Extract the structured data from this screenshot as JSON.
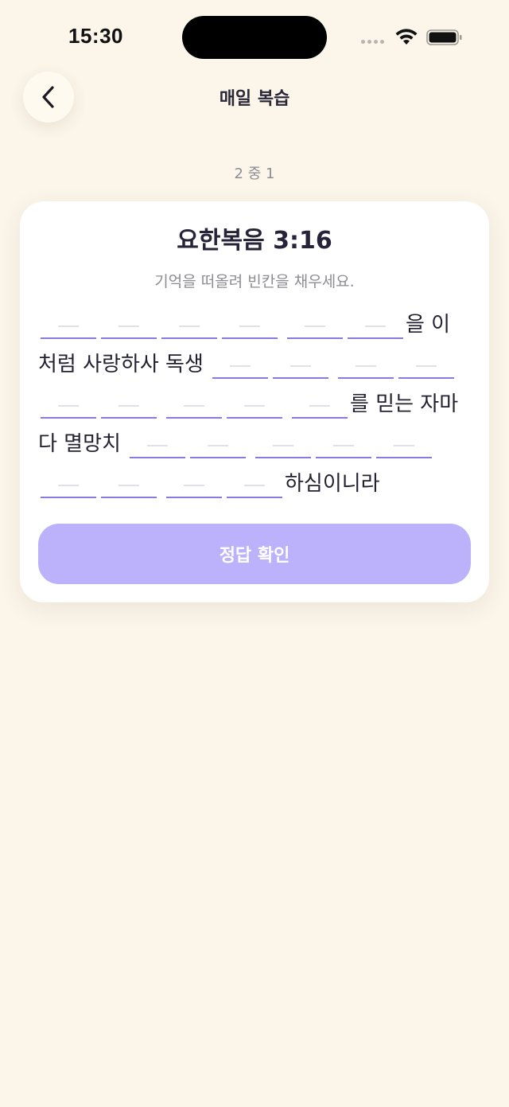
{
  "status_bar": {
    "time": "15:30"
  },
  "header": {
    "back_icon": "chevron-left-icon",
    "title": "매일 복습"
  },
  "progress": {
    "text": "2 중 1"
  },
  "card": {
    "verse_reference": "요한복음 3:16",
    "instruction": "기억을 떠올려 빈칸을 채우세요.",
    "segments": [
      {
        "type": "blank"
      },
      {
        "type": "blank"
      },
      {
        "type": "blank"
      },
      {
        "type": "blank"
      },
      {
        "type": "gap"
      },
      {
        "type": "blank"
      },
      {
        "type": "blank"
      },
      {
        "type": "text",
        "value": "을 이"
      },
      {
        "type": "text",
        "value": "처럼 사랑하사 독생"
      },
      {
        "type": "blank"
      },
      {
        "type": "blank"
      },
      {
        "type": "gap"
      },
      {
        "type": "blank"
      },
      {
        "type": "blank"
      },
      {
        "type": "blank"
      },
      {
        "type": "blank"
      },
      {
        "type": "gap"
      },
      {
        "type": "blank"
      },
      {
        "type": "blank"
      },
      {
        "type": "gap"
      },
      {
        "type": "blank"
      },
      {
        "type": "text",
        "value": "를 믿는 자마"
      },
      {
        "type": "text",
        "value": "다 멸망치"
      },
      {
        "type": "blank"
      },
      {
        "type": "blank"
      },
      {
        "type": "gap"
      },
      {
        "type": "blank"
      },
      {
        "type": "blank"
      },
      {
        "type": "blank"
      },
      {
        "type": "blank"
      },
      {
        "type": "blank"
      },
      {
        "type": "gap"
      },
      {
        "type": "blank"
      },
      {
        "type": "blank"
      },
      {
        "type": "text",
        "value": "하심이니라"
      }
    ],
    "check_button_label": "정답 확인"
  },
  "colors": {
    "background": "#fbf5ea",
    "accent": "#8a78e3",
    "button_disabled": "#bcb1fb"
  }
}
